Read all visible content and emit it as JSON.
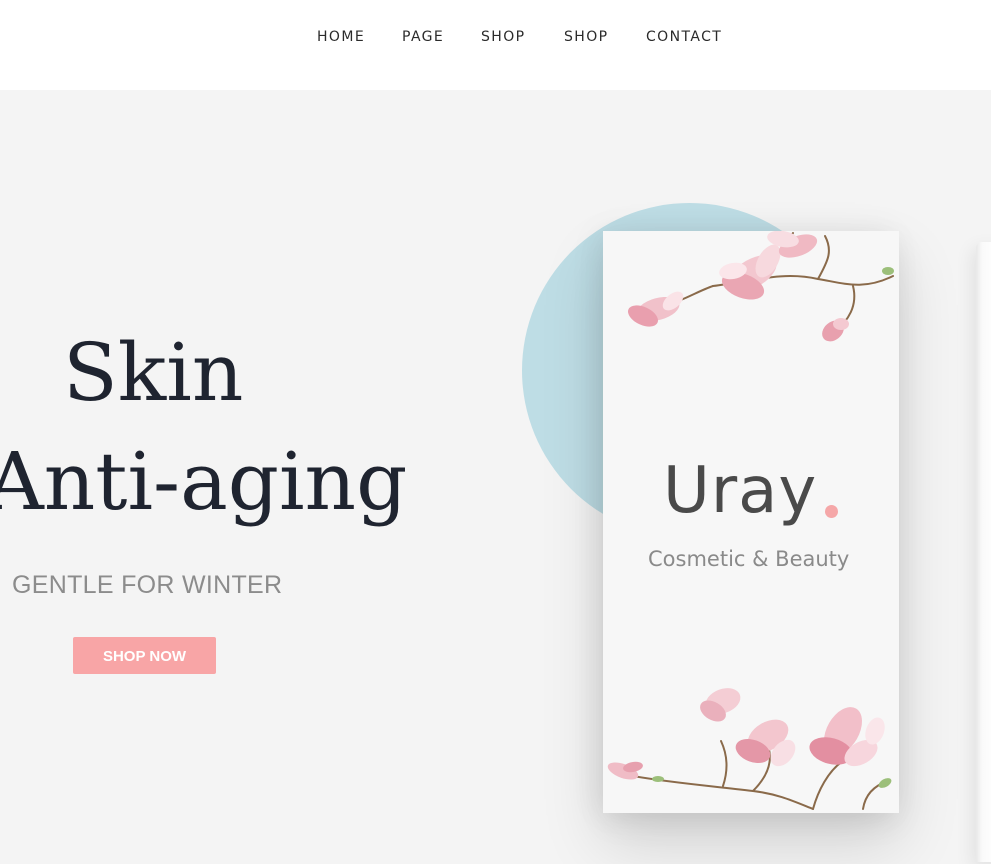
{
  "nav": {
    "items": [
      {
        "label": "HOME"
      },
      {
        "label": "PAGE"
      },
      {
        "label": "SHOP"
      },
      {
        "label": "SHOP"
      },
      {
        "label": "CONTACT"
      }
    ]
  },
  "hero": {
    "title_line1": "Skin",
    "title_line2": "Anti-aging",
    "subtitle": "GENTLE FOR WINTER",
    "cta_label": "SHOP NOW"
  },
  "product_card": {
    "brand": "Uray",
    "tagline": "Cosmetic & Beauty"
  },
  "colors": {
    "accent": "#f8a5a6",
    "circle": "#bedde5",
    "background": "#f4f4f4",
    "title": "#1f2430"
  }
}
